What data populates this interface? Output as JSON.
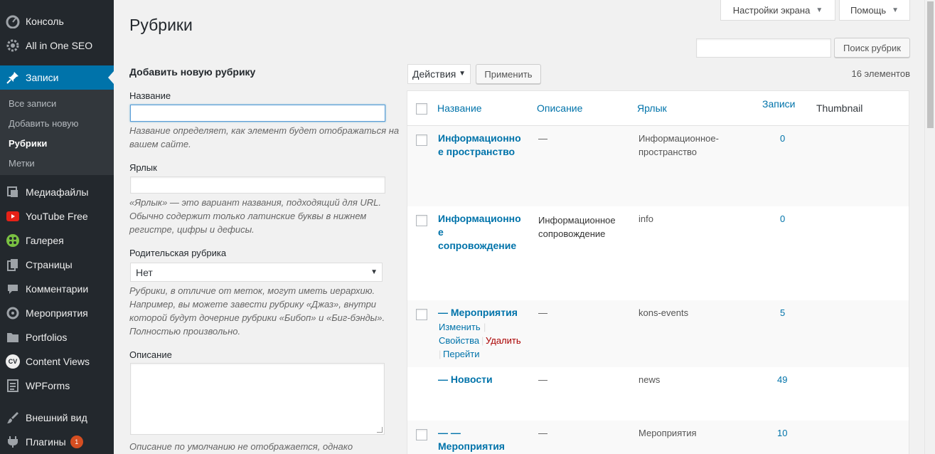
{
  "sidebar": {
    "items": [
      {
        "label": "Консоль",
        "icon": "dashboard-icon"
      },
      {
        "label": "All in One SEO",
        "icon": "gear-icon"
      },
      {
        "label": "Записи",
        "icon": "pin-icon"
      },
      {
        "label": "Медиафайлы",
        "icon": "media-icon"
      },
      {
        "label": "YouTube Free",
        "icon": "youtube-icon"
      },
      {
        "label": "Галерея",
        "icon": "gallery-icon"
      },
      {
        "label": "Страницы",
        "icon": "pages-icon"
      },
      {
        "label": "Комментарии",
        "icon": "comments-icon"
      },
      {
        "label": "Мероприятия",
        "icon": "events-icon"
      },
      {
        "label": "Portfolios",
        "icon": "folder-icon"
      },
      {
        "label": "Content Views",
        "icon": "cv-icon"
      },
      {
        "label": "WPForms",
        "icon": "forms-icon"
      },
      {
        "label": "Внешний вид",
        "icon": "brush-icon"
      },
      {
        "label": "Плагины",
        "icon": "plugin-icon",
        "badge": "1"
      }
    ],
    "submenu": [
      "Все записи",
      "Добавить новую",
      "Рубрики",
      "Метки"
    ],
    "cv_glyph": "CV",
    "colors": {
      "background": "#23282d",
      "active": "#0073aa",
      "submenu": "#32373c"
    }
  },
  "topbar": {
    "screen_options": "Настройки экрана",
    "help": "Помощь"
  },
  "page_title": "Рубрики",
  "search": {
    "button": "Поиск рубрик",
    "value": ""
  },
  "form": {
    "title": "Добавить новую рубрику",
    "name_label": "Название",
    "name_help_1": "Название определяет, как элемент будет отображаться на",
    "name_help_2": "вашем сайте.",
    "slug_label": "Ярлык",
    "slug_help_1": "«Ярлык» — это вариант названия, подходящий для URL.",
    "slug_help_2": "Обычно содержит только латинские буквы в нижнем",
    "slug_help_3": "регистре, цифры и дефисы.",
    "parent_label": "Родительская рубрика",
    "parent_value": "Нет",
    "parent_help_1": "Рубрики, в отличие от меток, могут иметь иерархию.",
    "parent_help_2": "Например, вы можете завести рубрику «Джаз», внутри",
    "parent_help_3": "которой будут дочерние рубрики «Бибоп» и «Биг-бэнды».",
    "parent_help_4": "Полностью произвольно.",
    "desc_label": "Описание",
    "desc_help": "Описание по умолчанию не отображается, однако"
  },
  "bulk": {
    "action": "Действия",
    "apply": "Применить",
    "count": "16 элементов"
  },
  "table": {
    "headers": {
      "name": "Название",
      "description": "Описание",
      "slug": "Ярлык",
      "posts": "Записи",
      "thumbnail": "Thumbnail"
    },
    "rows": [
      {
        "name_1": "Информационно",
        "name_2": "е пространство",
        "description": "—",
        "slug_1": "Информационное-",
        "slug_2": "пространство",
        "count": "0"
      },
      {
        "name_1": "Информационно",
        "name_2": "е",
        "name_3": "сопровождение",
        "description_1": "Информационное",
        "description_2": "сопровождение",
        "slug": "info",
        "count": "0"
      },
      {
        "name": "— Мероприятия",
        "description": "—",
        "slug": "kons-events",
        "count": "5",
        "actions": {
          "edit": "Изменить",
          "props": "Свойства",
          "delete": "Удалить",
          "view": "Перейти"
        }
      },
      {
        "name": "— Новости",
        "description": "—",
        "slug": "news",
        "count": "49"
      },
      {
        "name_1": "— —",
        "name_2": "Мероприятия",
        "description": "—",
        "slug": "Мероприятия",
        "count": "10"
      }
    ]
  }
}
